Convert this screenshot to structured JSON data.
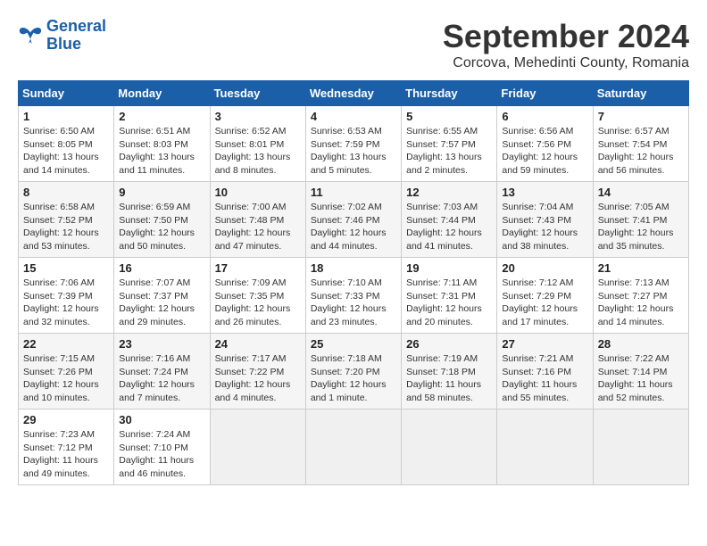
{
  "logo": {
    "line1": "General",
    "line2": "Blue"
  },
  "title": "September 2024",
  "subtitle": "Corcova, Mehedinti County, Romania",
  "days_of_week": [
    "Sunday",
    "Monday",
    "Tuesday",
    "Wednesday",
    "Thursday",
    "Friday",
    "Saturday"
  ],
  "weeks": [
    [
      {
        "day": "1",
        "sunrise": "Sunrise: 6:50 AM",
        "sunset": "Sunset: 8:05 PM",
        "daylight": "Daylight: 13 hours and 14 minutes."
      },
      {
        "day": "2",
        "sunrise": "Sunrise: 6:51 AM",
        "sunset": "Sunset: 8:03 PM",
        "daylight": "Daylight: 13 hours and 11 minutes."
      },
      {
        "day": "3",
        "sunrise": "Sunrise: 6:52 AM",
        "sunset": "Sunset: 8:01 PM",
        "daylight": "Daylight: 13 hours and 8 minutes."
      },
      {
        "day": "4",
        "sunrise": "Sunrise: 6:53 AM",
        "sunset": "Sunset: 7:59 PM",
        "daylight": "Daylight: 13 hours and 5 minutes."
      },
      {
        "day": "5",
        "sunrise": "Sunrise: 6:55 AM",
        "sunset": "Sunset: 7:57 PM",
        "daylight": "Daylight: 13 hours and 2 minutes."
      },
      {
        "day": "6",
        "sunrise": "Sunrise: 6:56 AM",
        "sunset": "Sunset: 7:56 PM",
        "daylight": "Daylight: 12 hours and 59 minutes."
      },
      {
        "day": "7",
        "sunrise": "Sunrise: 6:57 AM",
        "sunset": "Sunset: 7:54 PM",
        "daylight": "Daylight: 12 hours and 56 minutes."
      }
    ],
    [
      {
        "day": "8",
        "sunrise": "Sunrise: 6:58 AM",
        "sunset": "Sunset: 7:52 PM",
        "daylight": "Daylight: 12 hours and 53 minutes."
      },
      {
        "day": "9",
        "sunrise": "Sunrise: 6:59 AM",
        "sunset": "Sunset: 7:50 PM",
        "daylight": "Daylight: 12 hours and 50 minutes."
      },
      {
        "day": "10",
        "sunrise": "Sunrise: 7:00 AM",
        "sunset": "Sunset: 7:48 PM",
        "daylight": "Daylight: 12 hours and 47 minutes."
      },
      {
        "day": "11",
        "sunrise": "Sunrise: 7:02 AM",
        "sunset": "Sunset: 7:46 PM",
        "daylight": "Daylight: 12 hours and 44 minutes."
      },
      {
        "day": "12",
        "sunrise": "Sunrise: 7:03 AM",
        "sunset": "Sunset: 7:44 PM",
        "daylight": "Daylight: 12 hours and 41 minutes."
      },
      {
        "day": "13",
        "sunrise": "Sunrise: 7:04 AM",
        "sunset": "Sunset: 7:43 PM",
        "daylight": "Daylight: 12 hours and 38 minutes."
      },
      {
        "day": "14",
        "sunrise": "Sunrise: 7:05 AM",
        "sunset": "Sunset: 7:41 PM",
        "daylight": "Daylight: 12 hours and 35 minutes."
      }
    ],
    [
      {
        "day": "15",
        "sunrise": "Sunrise: 7:06 AM",
        "sunset": "Sunset: 7:39 PM",
        "daylight": "Daylight: 12 hours and 32 minutes."
      },
      {
        "day": "16",
        "sunrise": "Sunrise: 7:07 AM",
        "sunset": "Sunset: 7:37 PM",
        "daylight": "Daylight: 12 hours and 29 minutes."
      },
      {
        "day": "17",
        "sunrise": "Sunrise: 7:09 AM",
        "sunset": "Sunset: 7:35 PM",
        "daylight": "Daylight: 12 hours and 26 minutes."
      },
      {
        "day": "18",
        "sunrise": "Sunrise: 7:10 AM",
        "sunset": "Sunset: 7:33 PM",
        "daylight": "Daylight: 12 hours and 23 minutes."
      },
      {
        "day": "19",
        "sunrise": "Sunrise: 7:11 AM",
        "sunset": "Sunset: 7:31 PM",
        "daylight": "Daylight: 12 hours and 20 minutes."
      },
      {
        "day": "20",
        "sunrise": "Sunrise: 7:12 AM",
        "sunset": "Sunset: 7:29 PM",
        "daylight": "Daylight: 12 hours and 17 minutes."
      },
      {
        "day": "21",
        "sunrise": "Sunrise: 7:13 AM",
        "sunset": "Sunset: 7:27 PM",
        "daylight": "Daylight: 12 hours and 14 minutes."
      }
    ],
    [
      {
        "day": "22",
        "sunrise": "Sunrise: 7:15 AM",
        "sunset": "Sunset: 7:26 PM",
        "daylight": "Daylight: 12 hours and 10 minutes."
      },
      {
        "day": "23",
        "sunrise": "Sunrise: 7:16 AM",
        "sunset": "Sunset: 7:24 PM",
        "daylight": "Daylight: 12 hours and 7 minutes."
      },
      {
        "day": "24",
        "sunrise": "Sunrise: 7:17 AM",
        "sunset": "Sunset: 7:22 PM",
        "daylight": "Daylight: 12 hours and 4 minutes."
      },
      {
        "day": "25",
        "sunrise": "Sunrise: 7:18 AM",
        "sunset": "Sunset: 7:20 PM",
        "daylight": "Daylight: 12 hours and 1 minute."
      },
      {
        "day": "26",
        "sunrise": "Sunrise: 7:19 AM",
        "sunset": "Sunset: 7:18 PM",
        "daylight": "Daylight: 11 hours and 58 minutes."
      },
      {
        "day": "27",
        "sunrise": "Sunrise: 7:21 AM",
        "sunset": "Sunset: 7:16 PM",
        "daylight": "Daylight: 11 hours and 55 minutes."
      },
      {
        "day": "28",
        "sunrise": "Sunrise: 7:22 AM",
        "sunset": "Sunset: 7:14 PM",
        "daylight": "Daylight: 11 hours and 52 minutes."
      }
    ],
    [
      {
        "day": "29",
        "sunrise": "Sunrise: 7:23 AM",
        "sunset": "Sunset: 7:12 PM",
        "daylight": "Daylight: 11 hours and 49 minutes."
      },
      {
        "day": "30",
        "sunrise": "Sunrise: 7:24 AM",
        "sunset": "Sunset: 7:10 PM",
        "daylight": "Daylight: 11 hours and 46 minutes."
      },
      null,
      null,
      null,
      null,
      null
    ]
  ]
}
